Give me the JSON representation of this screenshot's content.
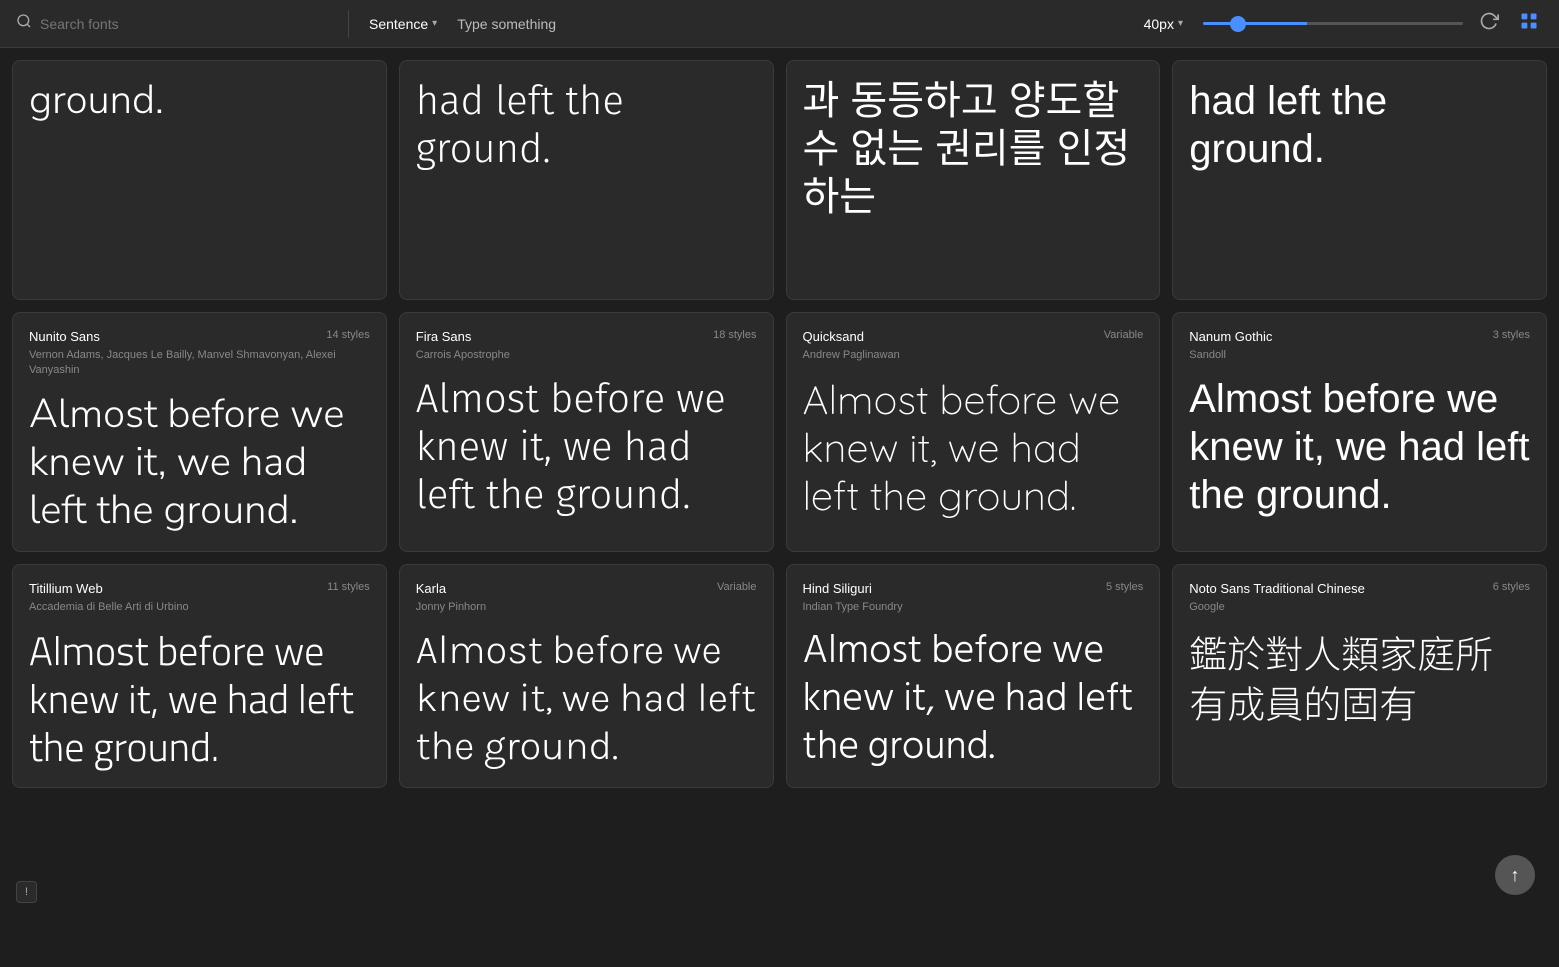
{
  "header": {
    "search_placeholder": "Search fonts",
    "sentence_label": "Sentence",
    "type_something": "Type something",
    "size_value": "40px",
    "chevron": "▾",
    "refresh_icon": "↺",
    "grid_icon": "⊞"
  },
  "top_partial_cards": [
    {
      "preview_text": "ground.",
      "font_class": "preview-nunito",
      "col": 1
    },
    {
      "preview_text": "had left the ground.",
      "font_class": "preview-fira",
      "col": 2
    },
    {
      "preview_text": "과 동등하고 양도할 수 없는 권리를 인정하는",
      "font_class": "preview-nanum",
      "is_korean": true,
      "col": 3
    },
    {
      "preview_text": "had left the ground.",
      "font_class": "preview-nanum",
      "col": 4
    }
  ],
  "font_cards": [
    {
      "name": "Nunito Sans",
      "styles": "14 styles",
      "authors": "Vernon Adams, Jacques Le Bailly, Manvel Shmavonyan, Alexei Vanyashin",
      "preview": "Almost before we knew it, we had left the ground.",
      "font_class": "preview-nunito"
    },
    {
      "name": "Fira Sans",
      "styles": "18 styles",
      "authors": "Carrois Apostrophe",
      "preview": "Almost before we knew it, we had left the ground.",
      "font_class": "preview-fira"
    },
    {
      "name": "Quicksand",
      "styles": "Variable",
      "authors": "Andrew Paglinawan",
      "preview": "Almost before we knew it, we had left the ground.",
      "font_class": "preview-quicksand"
    },
    {
      "name": "Nanum Gothic",
      "styles": "3 styles",
      "authors": "Sandoll",
      "preview": "Almost before we knew it, we had left the ground.",
      "font_class": "preview-nanum"
    },
    {
      "name": "Titillium Web",
      "styles": "11 styles",
      "authors": "Accademia di Belle Arti di Urbino",
      "preview": "Almost before we knew it, we had left the ground.",
      "font_class": "preview-titillium",
      "is_bottom": true
    },
    {
      "name": "Karla",
      "styles": "Variable",
      "authors": "Jonny Pinhorn",
      "preview": "Almost before we knew it, we had left the ground.",
      "font_class": "preview-karla",
      "is_bottom": true
    },
    {
      "name": "Hind Siliguri",
      "styles": "5 styles",
      "authors": "Indian Type Foundry",
      "preview": "Almost before we knew it, we had left the ground.",
      "font_class": "preview-hind",
      "is_bottom": true
    },
    {
      "name": "Noto Sans Traditional Chinese",
      "styles": "6 styles",
      "authors": "Google",
      "preview": "鑑於對人類家庭所有成員的固有",
      "font_class": "preview-noto-tc",
      "is_chinese": true,
      "is_bottom": true
    }
  ],
  "scroll_top_label": "↑",
  "feedback_label": "!"
}
